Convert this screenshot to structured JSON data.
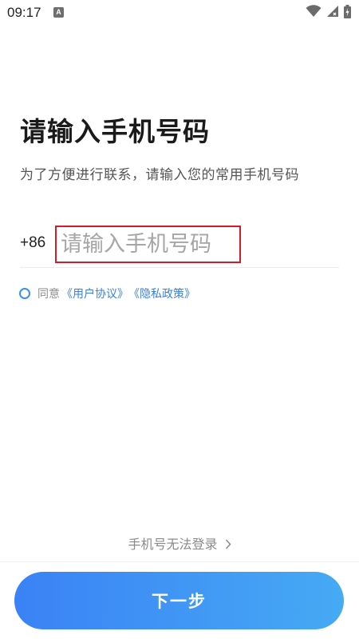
{
  "status_bar": {
    "time": "09:17",
    "notification_icon": "a-letter-icon",
    "icons": [
      "wifi-icon",
      "cellular-signal-icon",
      "battery-charging-icon"
    ]
  },
  "header": {
    "title": "请输入手机号码",
    "subtitle": "为了方便进行联系，请输入您的常用手机号码"
  },
  "phone": {
    "country_code": "+86",
    "placeholder": "请输入手机号码",
    "value": ""
  },
  "agreement": {
    "checked": false,
    "prefix": "同意",
    "user_agreement": "《用户协议》",
    "privacy_policy": "《隐私政策》"
  },
  "footer": {
    "cannot_login": "手机号无法登录",
    "next_label": "下一步"
  },
  "colors": {
    "accent": "#3a82f5",
    "link": "#3a7fe0",
    "highlight_border": "#d11d25"
  }
}
